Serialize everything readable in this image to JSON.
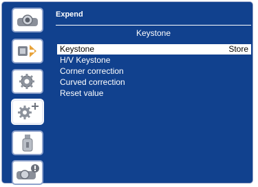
{
  "panel": {
    "title": "Expend",
    "submenu_title": "Keystone"
  },
  "menu": {
    "items": [
      {
        "label": "Keystone",
        "value": "Store",
        "selected": true
      },
      {
        "label": "H/V Keystone",
        "value": ""
      },
      {
        "label": "Corner correction",
        "value": ""
      },
      {
        "label": "Curved correction",
        "value": ""
      },
      {
        "label": "Reset value",
        "value": ""
      }
    ]
  },
  "sidebar": {
    "icons": [
      {
        "name": "display-icon"
      },
      {
        "name": "input-icon"
      },
      {
        "name": "settings-gear-icon"
      },
      {
        "name": "expand-gear-icon",
        "active": true
      },
      {
        "name": "usb-memory-icon"
      },
      {
        "name": "info-icon"
      }
    ]
  },
  "colors": {
    "panel_background": "#11418e",
    "selection_background": "#ffffff",
    "text": "#ffffff"
  }
}
